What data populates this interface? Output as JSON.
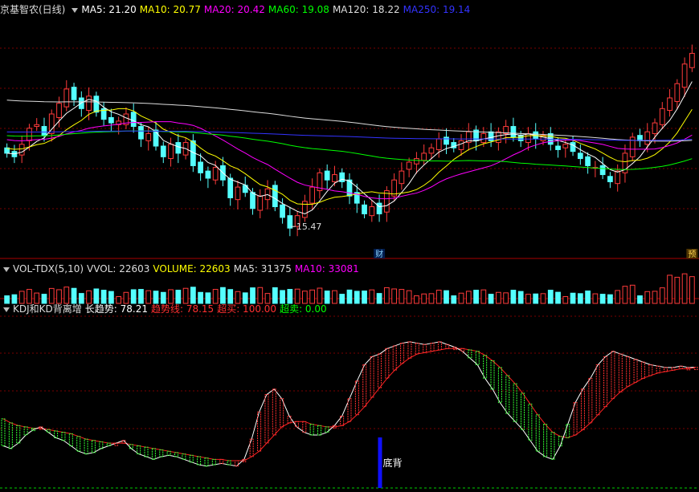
{
  "chart_data": [
    {
      "type": "candlestick",
      "title": "京基智农(日线)",
      "indicators": [
        {
          "label": "MA5: 21.20",
          "color": "#ffffff"
        },
        {
          "label": "MA10: 20.77",
          "color": "#ffff00"
        },
        {
          "label": "MA20: 20.42",
          "color": "#ff00ff"
        },
        {
          "label": "MA60: 19.08",
          "color": "#00ff00"
        },
        {
          "label": "MA120: 18.22",
          "color": "#dddddd"
        },
        {
          "label": "MA250: 19.14",
          "color": "#3333ff"
        }
      ],
      "ylim": [
        13.5,
        27.0
      ],
      "closes": [
        19.4,
        19.2,
        19.9,
        20.8,
        21.0,
        20.4,
        21.6,
        22.2,
        23.0,
        22.4,
        21.9,
        22.6,
        21.7,
        21.3,
        21.1,
        21.2,
        21.6,
        20.9,
        20.2,
        20.5,
        19.8,
        19.2,
        19.9,
        19.4,
        20.0,
        18.7,
        18.3,
        18.0,
        18.6,
        17.9,
        16.9,
        17.5,
        17.2,
        16.3,
        17.0,
        17.4,
        16.4,
        15.8,
        15.2,
        15.9,
        16.7,
        17.5,
        18.3,
        17.9,
        18.2,
        17.8,
        17.0,
        16.6,
        16.0,
        16.4,
        16.0,
        17.3,
        17.9,
        18.4,
        18.9,
        19.1,
        19.4,
        19.7,
        20.2,
        19.9,
        19.7,
        20.1,
        20.6,
        20.1,
        20.5,
        20.1,
        20.6,
        20.9,
        20.3,
        20.1,
        20.5,
        20.2,
        20.4,
        19.9,
        19.6,
        19.9,
        19.5,
        19.1,
        18.7,
        18.6,
        18.2,
        17.8,
        18.4,
        19.4,
        20.3,
        20.1,
        20.6,
        21.1,
        21.9,
        22.5,
        23.3,
        24.4,
        25.0
      ],
      "opens": [
        19.7,
        19.5,
        19.3,
        20.1,
        20.9,
        20.9,
        20.5,
        21.4,
        22.0,
        23.1,
        22.5,
        21.8,
        22.6,
        21.9,
        21.4,
        21.0,
        21.0,
        21.7,
        20.9,
        20.1,
        20.7,
        19.8,
        19.1,
        20.0,
        19.3,
        20.1,
        18.9,
        18.4,
        17.9,
        18.7,
        18.0,
        16.8,
        17.6,
        17.2,
        16.2,
        16.8,
        17.6,
        16.5,
        15.9,
        15.3,
        15.8,
        16.6,
        17.3,
        18.4,
        17.8,
        18.3,
        17.9,
        17.2,
        16.5,
        15.9,
        16.6,
        16.1,
        17.0,
        17.7,
        18.5,
        18.8,
        19.0,
        19.4,
        19.6,
        20.3,
        20.0,
        19.6,
        20.0,
        20.7,
        20.0,
        20.6,
        20.0,
        20.5,
        20.9,
        20.4,
        20.0,
        20.6,
        20.1,
        20.5,
        19.8,
        19.7,
        20.0,
        19.4,
        19.2,
        18.6,
        18.7,
        18.1,
        17.7,
        18.3,
        19.2,
        20.4,
        19.9,
        20.5,
        21.0,
        21.8,
        22.3,
        23.1,
        24.2
      ],
      "price_labels": [
        {
          "index": 38,
          "text": "15.47"
        }
      ],
      "markers": [
        {
          "index": 50,
          "text": "财"
        },
        {
          "index": 92,
          "text": "预"
        }
      ]
    },
    {
      "type": "bar",
      "indicators": [
        {
          "label": "VOL-TDX(5,10)",
          "color": "#dddddd"
        },
        {
          "label": "VVOL: 22603",
          "color": "#dddddd"
        },
        {
          "label": "VOLUME: 22603",
          "color": "#ffff00"
        },
        {
          "label": "MA5: 31375",
          "color": "#dddddd"
        },
        {
          "label": "MA10: 33081",
          "color": "#ff00ff"
        }
      ],
      "ylim": [
        0,
        70000
      ]
    },
    {
      "type": "line",
      "indicators": [
        {
          "label": "KDJ和KD背离增",
          "color": "#dddddd"
        },
        {
          "label": "长趋势: 78.21",
          "color": "#ffffff"
        },
        {
          "label": "趋势线: 78.15",
          "color": "#ff3030"
        },
        {
          "label": "超买: 100.00",
          "color": "#ff3030"
        },
        {
          "label": "超卖: 0.00",
          "color": "#00ff00"
        }
      ],
      "ylim": [
        -10,
        110
      ],
      "series": [
        {
          "name": "长趋势",
          "values": [
            20,
            18,
            22,
            28,
            32,
            34,
            30,
            26,
            24,
            20,
            16,
            14,
            15,
            18,
            20,
            22,
            24,
            18,
            14,
            12,
            10,
            12,
            13,
            12,
            10,
            8,
            6,
            5,
            6,
            7,
            6,
            5,
            10,
            25,
            45,
            58,
            62,
            55,
            42,
            34,
            30,
            28,
            28,
            30,
            35,
            42,
            55,
            68,
            80,
            86,
            88,
            92,
            94,
            96,
            97,
            96,
            95,
            96,
            97,
            95,
            93,
            90,
            85,
            80,
            70,
            62,
            52,
            44,
            38,
            32,
            24,
            16,
            12,
            10,
            20,
            36,
            52,
            62,
            70,
            80,
            86,
            90,
            88,
            86,
            84,
            82,
            80,
            79,
            78,
            78,
            79,
            78,
            78.21
          ]
        },
        {
          "name": "趋势线",
          "values": [
            40,
            37,
            35,
            34,
            33,
            33,
            32,
            31,
            30,
            29,
            27,
            25,
            24,
            23,
            22,
            22,
            22,
            21,
            20,
            19,
            18,
            17,
            16,
            15,
            14,
            13,
            12,
            11,
            10,
            10,
            9,
            9,
            9,
            12,
            16,
            22,
            28,
            34,
            37,
            38,
            38,
            36,
            35,
            34,
            34,
            35,
            38,
            43,
            49,
            56,
            63,
            70,
            76,
            81,
            85,
            88,
            89,
            90,
            91,
            92,
            92,
            92,
            91,
            90,
            87,
            83,
            78,
            72,
            66,
            59,
            51,
            43,
            36,
            30,
            27,
            26,
            28,
            32,
            37,
            43,
            49,
            55,
            60,
            64,
            67,
            70,
            72,
            74,
            75,
            76,
            77,
            77,
            78.15
          ]
        }
      ],
      "annotation": {
        "index": 50,
        "text": "底背"
      }
    }
  ]
}
